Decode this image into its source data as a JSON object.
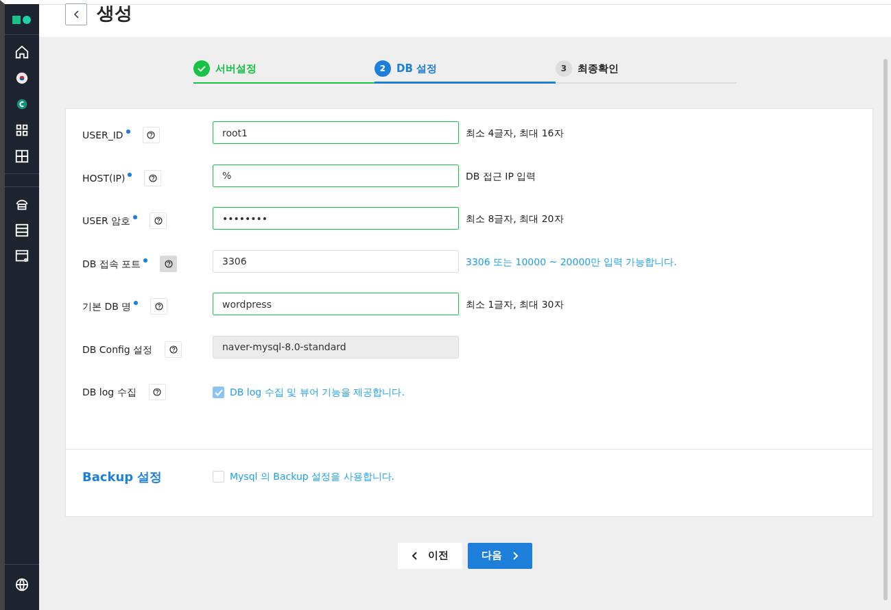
{
  "header": {
    "title": "생성"
  },
  "steps": [
    {
      "label": "서버설정",
      "completed": true,
      "selected": false
    },
    {
      "number": "2",
      "label": "DB 설정",
      "completed": false,
      "selected": true
    },
    {
      "number": "3",
      "label": "최종확인",
      "completed": false,
      "selected": false
    }
  ],
  "fields": [
    {
      "kind": "input",
      "label": "USER_ID",
      "required": true,
      "help_selected": false,
      "value": "root1",
      "valid": true,
      "hint": "최소 4글자, 최대 16자",
      "hint_emphasis": false
    },
    {
      "kind": "input",
      "label": "HOST(IP)",
      "required": true,
      "help_selected": false,
      "value": "%",
      "valid": true,
      "hint": "DB 접근 IP 입력",
      "hint_emphasis": false
    },
    {
      "kind": "input",
      "label": "USER 암호",
      "required": true,
      "help_selected": false,
      "value": "••••••••",
      "valid": true,
      "hint": "최소 8글자, 최대 20자",
      "hint_emphasis": false
    },
    {
      "kind": "input",
      "label": "DB 접속 포트",
      "required": true,
      "help_selected": true,
      "value": "3306",
      "valid": false,
      "hint": "3306 또는 10000 ~ 20000만 입력 가능합니다.",
      "hint_emphasis": true
    },
    {
      "kind": "input",
      "label": "기본 DB 명",
      "required": true,
      "help_selected": false,
      "value": "wordpress",
      "valid": true,
      "hint": "최소 1글자, 최대 30자",
      "hint_emphasis": false
    },
    {
      "kind": "readonly",
      "label": "DB Config 설정",
      "required": false,
      "help_selected": false,
      "value": "naver-mysql-8.0-standard"
    },
    {
      "kind": "checkbox",
      "label": "DB log 수집",
      "required": false,
      "help_selected": false,
      "checked": true,
      "disabled": true,
      "text": "DB log 수집 및 뷰어 기능을 제공합니다."
    }
  ],
  "backup": {
    "title": "Backup 설정",
    "checked": false,
    "text": "Mysql 의 Backup 설정을 사용합니다."
  },
  "buttons": [
    {
      "kind": "prev",
      "label": "이전"
    },
    {
      "kind": "next",
      "label": "다음"
    }
  ]
}
